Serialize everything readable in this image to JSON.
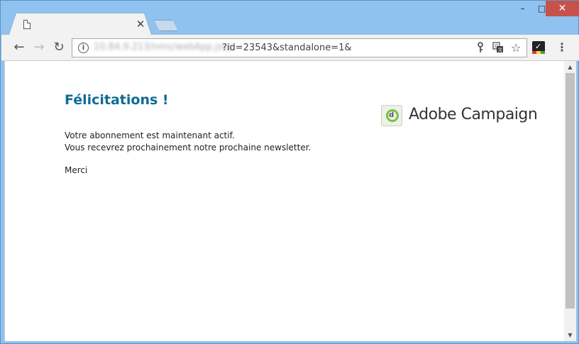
{
  "window": {
    "controls": {
      "minimize": "–",
      "maximize": "□",
      "close": "✕"
    }
  },
  "tab": {
    "close": "✕"
  },
  "toolbar": {
    "back": "←",
    "forward": "→",
    "reload": "↻",
    "url_host": "10.84.9.213/nms/webApp.jssp",
    "url_query": "?id=23543&standalone=1&",
    "icons": {
      "key": "key-icon",
      "translate": "translate-icon",
      "star": "star-icon",
      "extension": "extension-icon",
      "menu": "menu-icon"
    },
    "star": "☆",
    "menu": "⋮"
  },
  "page": {
    "title": "Félicitations !",
    "line1": "Votre abonnement est maintenant actif.",
    "line2": "Vous recevrez prochainement notre prochaine newsletter.",
    "thanks": "Merci",
    "logo_text": "Adobe Campaign",
    "colors": {
      "title": "#0f6b96",
      "logo_accent": "#7ac14a"
    }
  }
}
